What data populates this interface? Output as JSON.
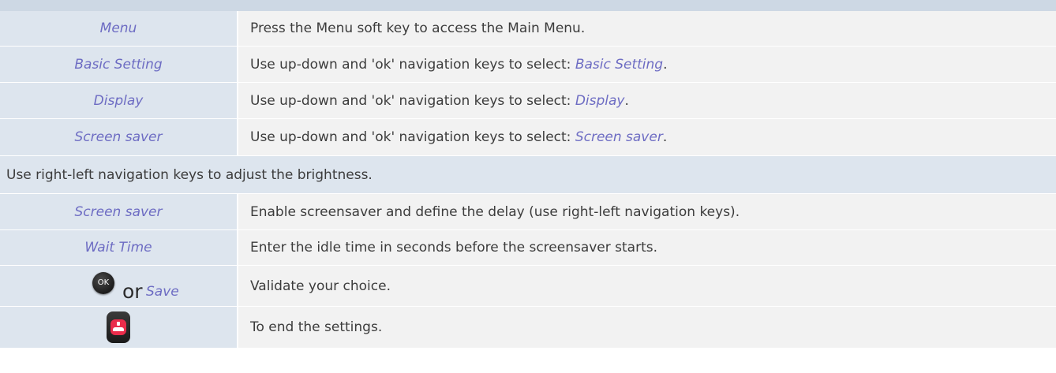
{
  "rows": [
    {
      "key": "Menu",
      "desc": "Press the Menu soft key to access the Main Menu."
    },
    {
      "key": "Basic Setting",
      "desc_prefix": "Use up-down and 'ok' navigation keys to select: ",
      "desc_em": "Basic Setting",
      "desc_suffix": "."
    },
    {
      "key": "Display",
      "desc_prefix": "Use up-down and 'ok' navigation keys to select: ",
      "desc_em": "Display",
      "desc_suffix": "."
    },
    {
      "key": "Screen saver",
      "desc_prefix": "Use up-down and 'ok' navigation keys to select: ",
      "desc_em": "Screen saver",
      "desc_suffix": "."
    },
    {
      "full": "Use right-left navigation keys to adjust the brightness."
    },
    {
      "key": "Screen saver",
      "desc": "Enable screensaver and define the delay (use right-left navigation keys)."
    },
    {
      "key": "Wait Time",
      "desc": "Enter the idle time in seconds before the screensaver starts."
    },
    {
      "ok_label": "OK",
      "or_label": "or",
      "save_label": "Save",
      "desc": "Validate your choice."
    },
    {
      "icon": "end-call-key-icon",
      "desc": "To end the settings."
    }
  ],
  "colors": {
    "header_band": "#cdd8e4",
    "key_cell_bg": "#dde5ee",
    "desc_cell_bg": "#f2f2f2",
    "key_text": "#6d6cc3",
    "body_text": "#3c3c3c",
    "end_key_red": "#ea2c4b"
  }
}
